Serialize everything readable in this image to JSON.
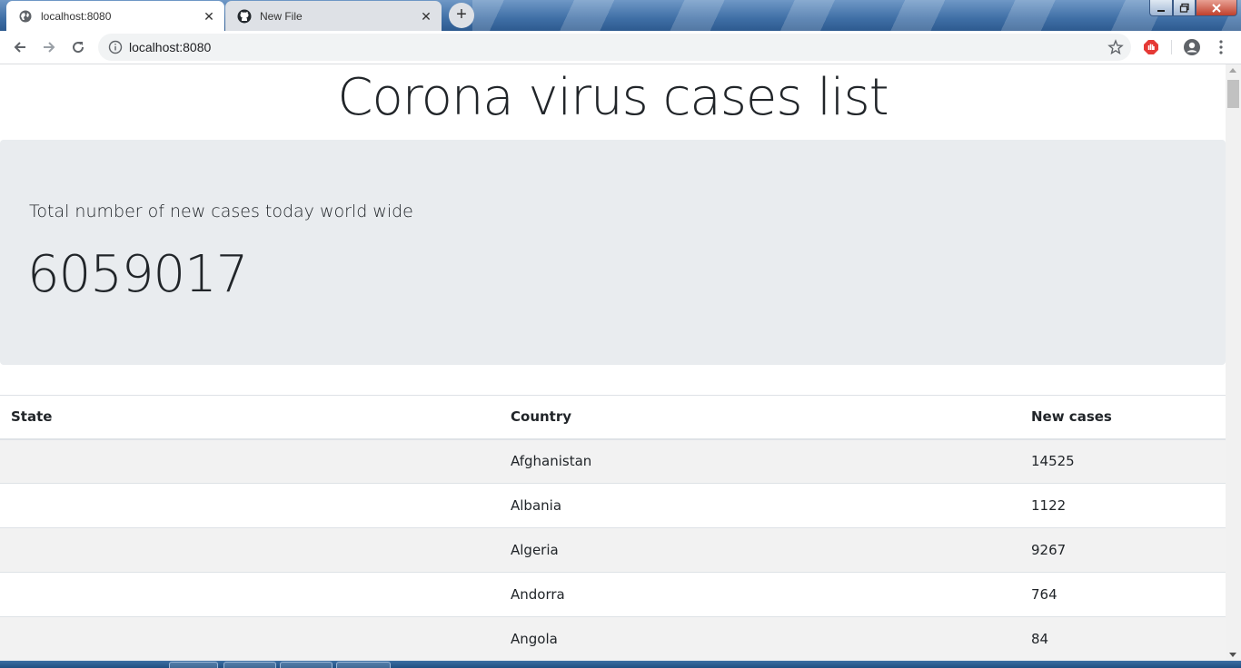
{
  "browser": {
    "tabs": [
      {
        "label": "localhost:8080",
        "icon": "globe-icon",
        "active": true
      },
      {
        "label": "New File",
        "icon": "github-icon",
        "active": false
      }
    ],
    "new_tab_symbol": "+",
    "close_symbol": "✕",
    "url": "localhost:8080"
  },
  "page": {
    "title": "Corona virus cases list",
    "summary_label": "Total number of new cases today world wide",
    "summary_value": "6059017"
  },
  "table": {
    "headers": [
      "State",
      "Country",
      "New cases"
    ],
    "rows": [
      {
        "state": "",
        "country": "Afghanistan",
        "new_cases": "14525"
      },
      {
        "state": "",
        "country": "Albania",
        "new_cases": "1122"
      },
      {
        "state": "",
        "country": "Algeria",
        "new_cases": "9267"
      },
      {
        "state": "",
        "country": "Andorra",
        "new_cases": "764"
      },
      {
        "state": "",
        "country": "Angola",
        "new_cases": "84"
      }
    ]
  },
  "colors": {
    "jumbotron_bg": "#e9ecef",
    "stripe_bg": "#f2f2f2",
    "text": "#212529"
  }
}
